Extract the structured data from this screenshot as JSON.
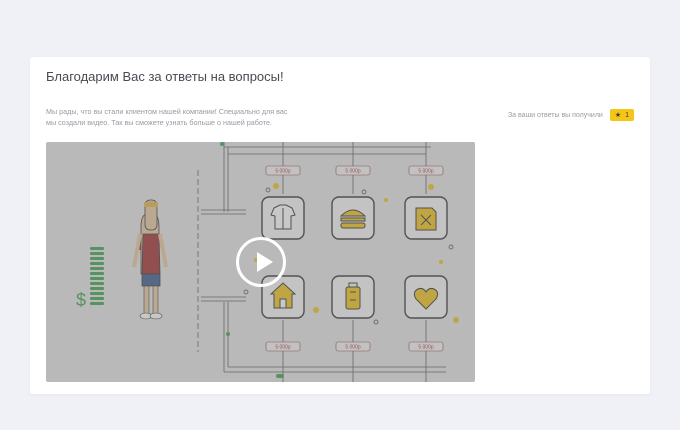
{
  "page": {
    "title": "Благодарим Вас за ответы на вопросы!",
    "description_lines": [
      "Мы рады, что вы стали клиентом нашей компании! Специально для вас",
      "мы создали видео. Так вы сможете узнать больше о нашей работе."
    ]
  },
  "reward": {
    "text": "За ваши ответы вы получили",
    "count": "1",
    "icon": "star-icon",
    "badge_color": "#f5c518"
  },
  "video": {
    "price_tag": "5 000р",
    "icons": [
      "shirt-icon",
      "burger-icon",
      "fuel-can-icon",
      "house-icon",
      "suitcase-icon",
      "heart-icon"
    ],
    "accent_color": "#f0c419",
    "overlay_color": "#8a8a8a"
  }
}
